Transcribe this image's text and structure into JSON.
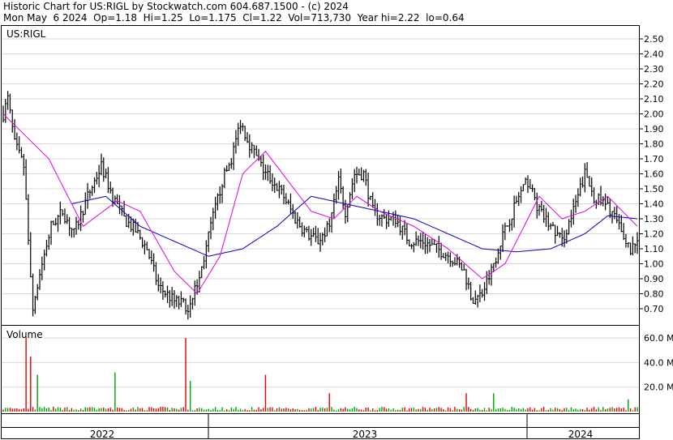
{
  "header": {
    "line1": "Historic Chart for US:RIGL by Stockwatch.com 604.687.1500 - (c) 2024",
    "line2": "Mon May  6 2024  Op=1.18  Hi=1.25  Lo=1.175  Cl=1.22  Vol=713,730  Year hi=2.22  lo=0.64"
  },
  "chart_data": {
    "type": "line",
    "symbol_label": "US:RIGL",
    "volume_label": "Volume",
    "price_ticks": [
      "2.50",
      "2.40",
      "2.30",
      "2.20",
      "2.10",
      "2.00",
      "1.90",
      "1.80",
      "1.70",
      "1.60",
      "1.50",
      "1.40",
      "1.30",
      "1.20",
      "1.10",
      "1.00",
      "0.90",
      "0.80",
      "0.70"
    ],
    "volume_ticks": [
      "60.0 M",
      "40.0 M",
      "20.0 M"
    ],
    "x_labels": [
      "2022",
      "2023",
      "2024"
    ],
    "ylim": [
      0.6,
      2.55
    ],
    "volume_ylim": [
      0,
      70
    ],
    "colors": {
      "price": "#000000",
      "ma_fast": "#e000e0",
      "ma_slow": "#0000c0",
      "vol_up": "#00a000",
      "vol_down": "#e00000",
      "grid": "#d8d8d8"
    },
    "price_anchors": [
      [
        0,
        2.0
      ],
      [
        2,
        2.1
      ],
      [
        5,
        1.8
      ],
      [
        9,
        1.65
      ],
      [
        13,
        0.7
      ],
      [
        17,
        1.0
      ],
      [
        21,
        1.25
      ],
      [
        26,
        1.35
      ],
      [
        31,
        1.2
      ],
      [
        37,
        1.45
      ],
      [
        43,
        1.65
      ],
      [
        48,
        1.45
      ],
      [
        53,
        1.3
      ],
      [
        58,
        1.22
      ],
      [
        63,
        1.1
      ],
      [
        68,
        0.85
      ],
      [
        75,
        0.75
      ],
      [
        81,
        0.72
      ],
      [
        86,
        0.9
      ],
      [
        91,
        1.25
      ],
      [
        96,
        1.55
      ],
      [
        100,
        1.7
      ],
      [
        104,
        1.95
      ],
      [
        108,
        1.8
      ],
      [
        113,
        1.65
      ],
      [
        118,
        1.55
      ],
      [
        123,
        1.45
      ],
      [
        128,
        1.3
      ],
      [
        133,
        1.2
      ],
      [
        138,
        1.15
      ],
      [
        143,
        1.25
      ],
      [
        147,
        1.55
      ],
      [
        150,
        1.35
      ],
      [
        154,
        1.6
      ],
      [
        158,
        1.6
      ],
      [
        162,
        1.35
      ],
      [
        167,
        1.3
      ],
      [
        172,
        1.3
      ],
      [
        178,
        1.15
      ],
      [
        184,
        1.15
      ],
      [
        190,
        1.1
      ],
      [
        196,
        1.05
      ],
      [
        202,
        0.95
      ],
      [
        206,
        0.75
      ],
      [
        210,
        0.8
      ],
      [
        214,
        0.95
      ],
      [
        218,
        1.15
      ],
      [
        222,
        1.3
      ],
      [
        226,
        1.45
      ],
      [
        230,
        1.55
      ],
      [
        235,
        1.35
      ],
      [
        240,
        1.25
      ],
      [
        245,
        1.15
      ],
      [
        250,
        1.35
      ],
      [
        255,
        1.6
      ],
      [
        259,
        1.45
      ],
      [
        263,
        1.4
      ],
      [
        267,
        1.35
      ],
      [
        271,
        1.2
      ],
      [
        275,
        1.1
      ],
      [
        278,
        1.15
      ]
    ],
    "ma_fast": [
      [
        0,
        2.0
      ],
      [
        20,
        1.7
      ],
      [
        35,
        1.25
      ],
      [
        50,
        1.42
      ],
      [
        60,
        1.35
      ],
      [
        75,
        0.95
      ],
      [
        85,
        0.8
      ],
      [
        95,
        1.05
      ],
      [
        105,
        1.6
      ],
      [
        115,
        1.75
      ],
      [
        125,
        1.55
      ],
      [
        135,
        1.35
      ],
      [
        145,
        1.3
      ],
      [
        155,
        1.45
      ],
      [
        165,
        1.35
      ],
      [
        180,
        1.25
      ],
      [
        195,
        1.1
      ],
      [
        210,
        0.9
      ],
      [
        220,
        1.0
      ],
      [
        235,
        1.45
      ],
      [
        245,
        1.3
      ],
      [
        255,
        1.35
      ],
      [
        265,
        1.45
      ],
      [
        278,
        1.25
      ]
    ],
    "ma_slow": [
      [
        30,
        1.4
      ],
      [
        45,
        1.45
      ],
      [
        60,
        1.25
      ],
      [
        75,
        1.15
      ],
      [
        90,
        1.05
      ],
      [
        105,
        1.1
      ],
      [
        120,
        1.25
      ],
      [
        135,
        1.45
      ],
      [
        150,
        1.4
      ],
      [
        165,
        1.35
      ],
      [
        180,
        1.3
      ],
      [
        195,
        1.2
      ],
      [
        210,
        1.1
      ],
      [
        225,
        1.08
      ],
      [
        240,
        1.1
      ],
      [
        255,
        1.2
      ],
      [
        265,
        1.32
      ],
      [
        278,
        1.3
      ]
    ],
    "volume_spikes": [
      [
        10,
        60
      ],
      [
        12,
        45
      ],
      [
        15,
        30
      ],
      [
        49,
        32
      ],
      [
        80,
        60
      ],
      [
        82,
        25
      ],
      [
        115,
        30
      ],
      [
        143,
        15
      ],
      [
        203,
        15
      ],
      [
        215,
        15
      ],
      [
        274,
        10
      ]
    ]
  }
}
